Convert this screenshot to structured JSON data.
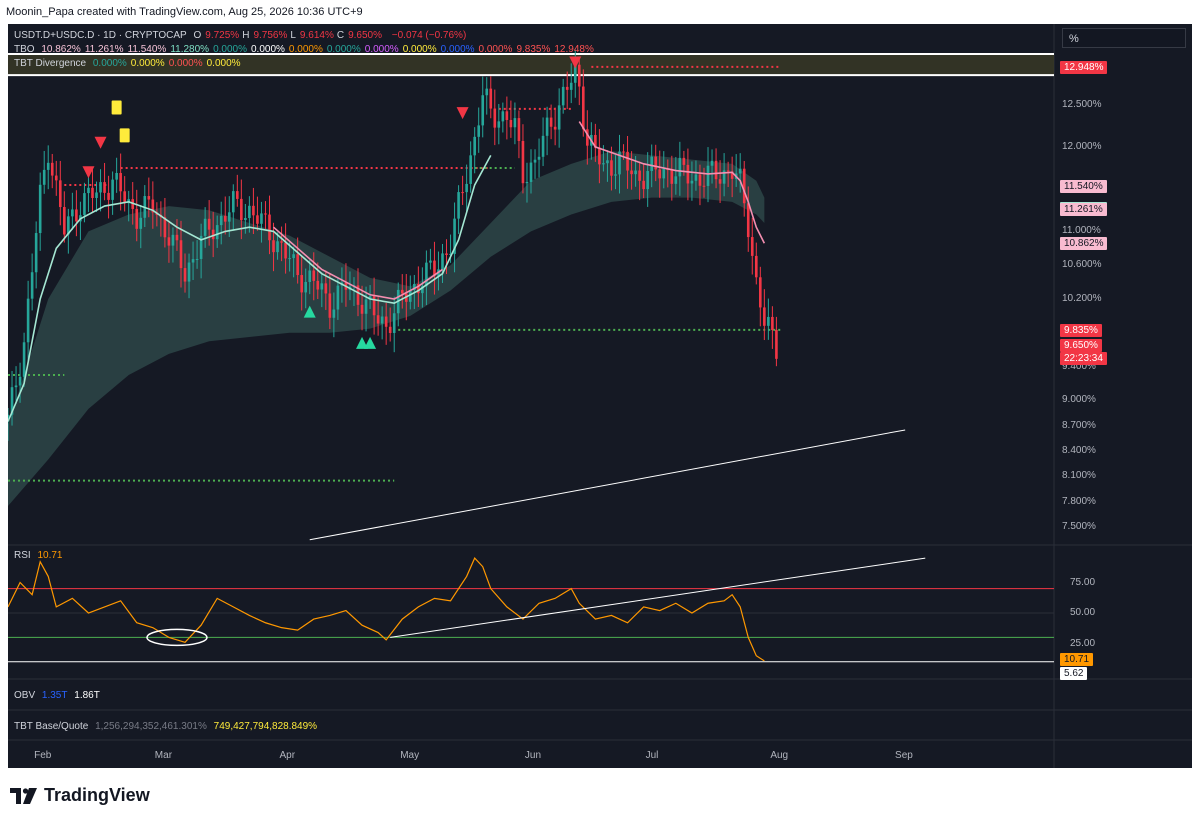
{
  "header": {
    "attribution": "Moonin_Papa created with TradingView.com, Aug 25, 2026 10:36 UTC+9"
  },
  "legend": {
    "symbol": "USDT.D+USDC.D · 1D · CRYPTOCAP",
    "ohlc": [
      {
        "k": "O",
        "v": "9.725%"
      },
      {
        "k": "H",
        "v": "9.756%"
      },
      {
        "k": "L",
        "v": "9.614%"
      },
      {
        "k": "C",
        "v": "9.650%"
      }
    ],
    "change": "−0.074 (−0.76%)",
    "tbo_name": "TBO",
    "tbo_values": [
      "10.862%",
      "11.261%",
      "11.540%",
      "11.280%",
      "0.000%",
      "0.000%",
      "0.000%",
      "0.000%",
      "0.000%",
      "0.000%",
      "0.000%",
      "0.000%",
      "9.835%",
      "12.948%"
    ],
    "tbo_colors": [
      "#f7c4d8",
      "#f7c4d8",
      "#f7c4d8",
      "#7fe0c5",
      "#26a69a",
      "#ffffff",
      "#ff9800",
      "#26a69a",
      "#d45dff",
      "#ffeb3b",
      "#2962ff",
      "#ff5252",
      "#ff5252",
      "#ff5252"
    ],
    "div_name": "TBT Divergence",
    "div_values": [
      "0.000%",
      "0.000%",
      "0.000%",
      "0.000%"
    ],
    "div_colors": [
      "#26a69a",
      "#ffeb3b",
      "#ff5252",
      "#ffeb3b"
    ]
  },
  "percent_button": "%",
  "price_axis": {
    "ticks": [
      "12.500%",
      "12.000%",
      "11.000%",
      "10.600%",
      "10.200%",
      "9.400%",
      "9.000%",
      "8.700%",
      "8.400%",
      "8.100%",
      "7.800%",
      "7.500%"
    ],
    "tags": [
      {
        "text": "12.948%",
        "bg": "#f23645",
        "fg": "#ffffff"
      },
      {
        "text": "11.540%",
        "bg": "#f8bbd0",
        "fg": "#131722"
      },
      {
        "text": "11.280%",
        "bg": "#a5e7d3",
        "fg": "#131722"
      },
      {
        "text": "11.261%",
        "bg": "#f8bbd0",
        "fg": "#131722"
      },
      {
        "text": "10.862%",
        "bg": "#f8bbd0",
        "fg": "#131722"
      },
      {
        "text": "9.835%",
        "bg": "#f23645",
        "fg": "#ffffff"
      },
      {
        "text": "9.650%",
        "bg": "#f23645",
        "fg": "#ffffff"
      },
      {
        "text": "22:23:34",
        "bg": "#f23645",
        "fg": "#ffffff"
      }
    ]
  },
  "rsi": {
    "name": "RSI",
    "value": "10.71",
    "ticks": [
      "75.00",
      "50.00",
      "25.00"
    ],
    "tags": [
      {
        "text": "10.71",
        "bg": "#ff9800",
        "fg": "#131722"
      },
      {
        "text": "5.62",
        "bg": "#ffffff",
        "fg": "#131722"
      }
    ]
  },
  "obv": {
    "name": "OBV",
    "v1": "1.35T",
    "v2": "1.86T"
  },
  "bq": {
    "name": "TBT Base/Quote",
    "v1": "1,256,294,352,461.301%",
    "v2": "749,427,794,828.849%"
  },
  "months": [
    "Feb",
    "Mar",
    "Apr",
    "May",
    "Jun",
    "Jul",
    "Aug",
    "Sep"
  ],
  "footer": {
    "brand": "TradingView"
  },
  "chart_data": {
    "type": "candlestick",
    "title": "USDT.D+USDC.D · 1D · CRYPTOCAP",
    "x_ticks": [
      "Feb",
      "Mar",
      "Apr",
      "May",
      "Jun",
      "Jul",
      "Aug",
      "Sep"
    ],
    "ylim": [
      7.3,
      13.1
    ],
    "close_path": [
      [
        0,
        8.75
      ],
      [
        4,
        9.7
      ],
      [
        8,
        11.4
      ],
      [
        10,
        12.0
      ],
      [
        14,
        11.0
      ],
      [
        18,
        11.35
      ],
      [
        22,
        11.45
      ],
      [
        26,
        11.6
      ],
      [
        28,
        11.45
      ],
      [
        32,
        11.2
      ],
      [
        36,
        11.3
      ],
      [
        40,
        10.95
      ],
      [
        44,
        10.5
      ],
      [
        48,
        10.9
      ],
      [
        52,
        11.1
      ],
      [
        56,
        11.3
      ],
      [
        60,
        11.25
      ],
      [
        64,
        11.05
      ],
      [
        68,
        10.8
      ],
      [
        72,
        10.5
      ],
      [
        76,
        10.4
      ],
      [
        80,
        10.15
      ],
      [
        84,
        10.35
      ],
      [
        88,
        10.2
      ],
      [
        92,
        9.95
      ],
      [
        94,
        9.9
      ],
      [
        98,
        10.2
      ],
      [
        102,
        10.4
      ],
      [
        106,
        10.55
      ],
      [
        110,
        10.85
      ],
      [
        114,
        11.7
      ],
      [
        116,
        12.1
      ],
      [
        118,
        12.6
      ],
      [
        120,
        12.4
      ],
      [
        124,
        12.35
      ],
      [
        126,
        12.2
      ],
      [
        128,
        11.7
      ],
      [
        131,
        11.8
      ],
      [
        134,
        12.2
      ],
      [
        138,
        12.6
      ],
      [
        141,
        12.85
      ],
      [
        142,
        12.7
      ],
      [
        144,
        12.1
      ],
      [
        148,
        11.75
      ],
      [
        152,
        11.85
      ],
      [
        156,
        11.65
      ],
      [
        160,
        11.7
      ],
      [
        164,
        11.72
      ],
      [
        168,
        11.68
      ],
      [
        172,
        11.62
      ],
      [
        176,
        11.68
      ],
      [
        180,
        11.72
      ],
      [
        182,
        11.55
      ],
      [
        184,
        11.1
      ],
      [
        186,
        10.4
      ],
      [
        188,
        9.9
      ],
      [
        190,
        9.75
      ],
      [
        191,
        9.65
      ]
    ],
    "ema_fast": [
      [
        0,
        8.75
      ],
      [
        4,
        9.2
      ],
      [
        8,
        10.2
      ],
      [
        12,
        10.8
      ],
      [
        18,
        11.15
      ],
      [
        24,
        11.3
      ],
      [
        30,
        11.35
      ],
      [
        36,
        11.25
      ],
      [
        42,
        11.05
      ],
      [
        48,
        10.9
      ],
      [
        54,
        11.0
      ],
      [
        60,
        11.05
      ],
      [
        66,
        11.0
      ],
      [
        72,
        10.75
      ],
      [
        78,
        10.5
      ],
      [
        84,
        10.35
      ],
      [
        90,
        10.2
      ],
      [
        96,
        10.15
      ],
      [
        102,
        10.3
      ],
      [
        108,
        10.5
      ],
      [
        112,
        10.9
      ],
      [
        116,
        11.55
      ],
      [
        120,
        11.9
      ],
      [
        126,
        11.95
      ],
      [
        132,
        11.9
      ],
      [
        138,
        12.15
      ],
      [
        142,
        12.3
      ],
      [
        146,
        12.0
      ],
      [
        152,
        11.9
      ],
      [
        158,
        11.8
      ],
      [
        166,
        11.72
      ],
      [
        174,
        11.68
      ],
      [
        180,
        11.7
      ],
      [
        182,
        11.6
      ],
      [
        184,
        11.35
      ],
      [
        186,
        11.05
      ],
      [
        188,
        10.86
      ]
    ],
    "cloud_upper": [
      [
        0,
        8.7
      ],
      [
        10,
        10.2
      ],
      [
        20,
        11.0
      ],
      [
        30,
        11.2
      ],
      [
        40,
        11.3
      ],
      [
        50,
        11.25
      ],
      [
        60,
        11.1
      ],
      [
        70,
        10.95
      ],
      [
        80,
        10.7
      ],
      [
        90,
        10.45
      ],
      [
        100,
        10.35
      ],
      [
        110,
        10.6
      ],
      [
        120,
        11.1
      ],
      [
        130,
        11.6
      ],
      [
        140,
        11.8
      ],
      [
        150,
        11.95
      ],
      [
        160,
        11.9
      ],
      [
        170,
        11.85
      ],
      [
        180,
        11.8
      ],
      [
        186,
        11.6
      ],
      [
        188,
        11.4
      ]
    ],
    "cloud_lower": [
      [
        0,
        7.75
      ],
      [
        10,
        8.3
      ],
      [
        20,
        8.9
      ],
      [
        30,
        9.3
      ],
      [
        40,
        9.55
      ],
      [
        50,
        9.7
      ],
      [
        60,
        9.75
      ],
      [
        70,
        9.8
      ],
      [
        80,
        9.8
      ],
      [
        90,
        9.85
      ],
      [
        100,
        10.0
      ],
      [
        110,
        10.3
      ],
      [
        120,
        10.7
      ],
      [
        130,
        11.0
      ],
      [
        140,
        11.2
      ],
      [
        150,
        11.35
      ],
      [
        160,
        11.4
      ],
      [
        170,
        11.4
      ],
      [
        180,
        11.35
      ],
      [
        186,
        11.2
      ],
      [
        188,
        11.1
      ]
    ],
    "hlines": [
      {
        "name": "12.948%",
        "y": 12.948
      },
      {
        "name": "9.835%",
        "y": 9.835
      }
    ],
    "rsi_series": [
      [
        0,
        55
      ],
      [
        3,
        75
      ],
      [
        6,
        65
      ],
      [
        8,
        92
      ],
      [
        10,
        80
      ],
      [
        12,
        55
      ],
      [
        16,
        62
      ],
      [
        20,
        50
      ],
      [
        24,
        55
      ],
      [
        28,
        60
      ],
      [
        32,
        42
      ],
      [
        36,
        38
      ],
      [
        40,
        30
      ],
      [
        44,
        26
      ],
      [
        48,
        40
      ],
      [
        52,
        62
      ],
      [
        56,
        55
      ],
      [
        60,
        48
      ],
      [
        64,
        42
      ],
      [
        68,
        38
      ],
      [
        72,
        36
      ],
      [
        76,
        45
      ],
      [
        80,
        48
      ],
      [
        84,
        52
      ],
      [
        88,
        40
      ],
      [
        92,
        34
      ],
      [
        94,
        28
      ],
      [
        98,
        45
      ],
      [
        102,
        55
      ],
      [
        106,
        62
      ],
      [
        110,
        60
      ],
      [
        114,
        80
      ],
      [
        116,
        95
      ],
      [
        118,
        88
      ],
      [
        120,
        70
      ],
      [
        124,
        55
      ],
      [
        128,
        45
      ],
      [
        132,
        58
      ],
      [
        136,
        62
      ],
      [
        140,
        70
      ],
      [
        142,
        58
      ],
      [
        146,
        45
      ],
      [
        150,
        48
      ],
      [
        154,
        42
      ],
      [
        158,
        55
      ],
      [
        162,
        52
      ],
      [
        166,
        58
      ],
      [
        170,
        50
      ],
      [
        174,
        58
      ],
      [
        178,
        60
      ],
      [
        180,
        65
      ],
      [
        182,
        55
      ],
      [
        184,
        30
      ],
      [
        186,
        15
      ],
      [
        188,
        10.71
      ]
    ],
    "rsi_levels": [
      70,
      50,
      30
    ]
  }
}
